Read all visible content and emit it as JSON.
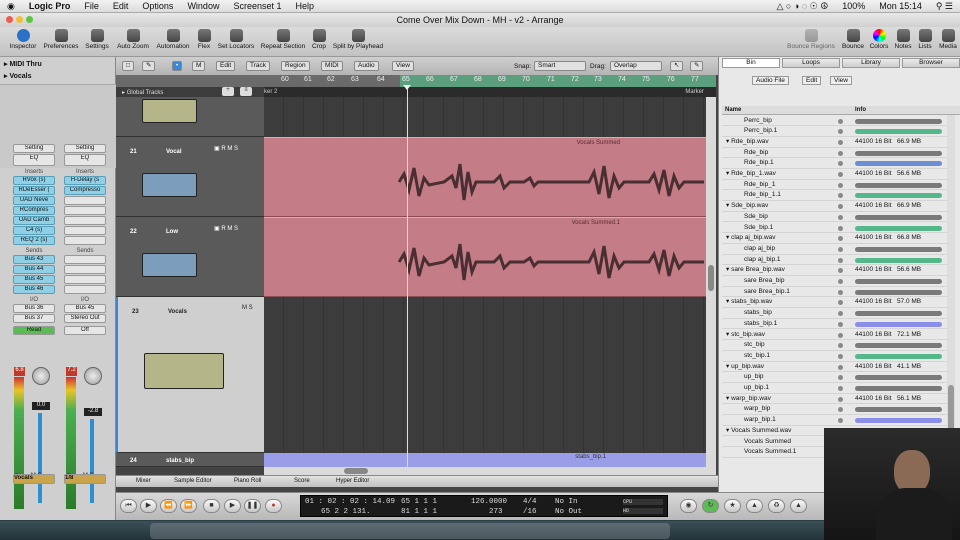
{
  "menubar": {
    "apple": "",
    "app": "Logic Pro",
    "items": [
      "File",
      "Edit",
      "Options",
      "Window",
      "Screenset 1",
      "Help"
    ],
    "battery": "100%",
    "clock": "Mon 15:14"
  },
  "window": {
    "title": "Come Over Mix Down - MH - v2 - Arrange"
  },
  "toolbar": {
    "left": [
      "Inspector",
      "Preferences",
      "Settings",
      "Auto Zoom",
      "Automation",
      "Flex",
      "Set Locators",
      "Repeat Section",
      "Crop",
      "Split by Playhead"
    ],
    "right": [
      "Bounce Regions",
      "Bounce",
      "Colors",
      "Notes",
      "Lists",
      "Media"
    ]
  },
  "inspector": {
    "midi_thru": "MIDI Thru",
    "vocals": "Vocals",
    "strip1": {
      "setting": "Setting",
      "eq": "EQ",
      "inserts_label": "Inserts",
      "inserts": [
        "RVox (s)",
        "RDeEsser (",
        "UAD Neve",
        "RCompres",
        "UAD Camb",
        "C4 (s)",
        "REQ 2 (s)"
      ],
      "sends_label": "Sends",
      "sends": [
        "Bus 43",
        "Bus 44",
        "Bus 45",
        "Bus 46"
      ],
      "io_label": "I/O",
      "io": [
        "Bus 36",
        "Bus 37"
      ],
      "auto": "Read",
      "peak": "6.8",
      "value": "0.0",
      "name": "Vocals"
    },
    "strip2": {
      "setting": "Setting",
      "eq": "EQ",
      "inserts_label": "Inserts",
      "inserts": [
        "H-Delay (s",
        "Compresso"
      ],
      "sends_label": "Sends",
      "io_label": "I/O",
      "io": [
        "Bus 45",
        "Stereo Out"
      ],
      "auto": "Off",
      "peak": "7.2",
      "value": "-2.8",
      "name": "1/8"
    }
  },
  "arrange": {
    "menu": [
      "Edit",
      "Track",
      "Region",
      "MIDI",
      "Audio",
      "View"
    ],
    "snap_label": "Snap:",
    "snap": "Smart",
    "drag_label": "Drag:",
    "drag": "Overlap",
    "ruler": [
      "60",
      "61",
      "62",
      "63",
      "64",
      "65",
      "66",
      "67",
      "68",
      "69",
      "70",
      "71",
      "72",
      "73",
      "74",
      "75",
      "76",
      "77"
    ],
    "global_tracks": "Global Tracks",
    "marker_left": "ker 2",
    "marker_right": "Marker",
    "tracks": [
      {
        "num": "21",
        "name": "Vocal"
      },
      {
        "num": "22",
        "name": "Low"
      },
      {
        "num": "23",
        "name": "Vocals"
      },
      {
        "num": "24",
        "name": "stabs_bip"
      }
    ],
    "regions": [
      "Vocals Summed",
      "Vocals Summed.1",
      "stabs_bip.1"
    ],
    "bottom_tabs": [
      "Mixer",
      "Sample Editor",
      "Piano Roll",
      "Score",
      "Hyper Editor"
    ]
  },
  "bin": {
    "tabs": [
      "Bin",
      "Loops",
      "Library",
      "Browser"
    ],
    "submenu": [
      "Audio File",
      "Edit",
      "View"
    ],
    "col_name": "Name",
    "col_info": "Info",
    "rows": [
      {
        "name": "Perrc_bip",
        "ind": 2,
        "type": "bar",
        "color": "#7a7a7a"
      },
      {
        "name": "Perrc_bip.1",
        "ind": 2,
        "type": "bar",
        "color": "#55b88a"
      },
      {
        "name": "Rde_bip.wav",
        "ind": 1,
        "type": "file",
        "info": "44100 16 Bit",
        "size": "66.9 MB"
      },
      {
        "name": "Rde_bip",
        "ind": 2,
        "type": "bar",
        "color": "#7a7a7a"
      },
      {
        "name": "Rde_bip.1",
        "ind": 2,
        "type": "bar",
        "color": "#6b8fd0"
      },
      {
        "name": "Rde_bip_1.wav",
        "ind": 1,
        "type": "file",
        "info": "44100 16 Bit",
        "size": "56.6 MB"
      },
      {
        "name": "Rde_bip_1",
        "ind": 2,
        "type": "bar",
        "color": "#7a7a7a"
      },
      {
        "name": "Rde_bip_1.1",
        "ind": 2,
        "type": "bar",
        "color": "#55b88a"
      },
      {
        "name": "Sde_bip.wav",
        "ind": 1,
        "type": "file",
        "info": "44100 16 Bit",
        "size": "66.9 MB"
      },
      {
        "name": "Sde_bip",
        "ind": 2,
        "type": "bar",
        "color": "#7a7a7a"
      },
      {
        "name": "Sde_bip.1",
        "ind": 2,
        "type": "bar",
        "color": "#55b88a"
      },
      {
        "name": "clap aj_bip.wav",
        "ind": 1,
        "type": "file",
        "info": "44100 16 Bit",
        "size": "66.8 MB"
      },
      {
        "name": "clap aj_bip",
        "ind": 2,
        "type": "bar",
        "color": "#7a7a7a"
      },
      {
        "name": "clap aj_bip.1",
        "ind": 2,
        "type": "bar",
        "color": "#55b88a"
      },
      {
        "name": "sare Brea_bip.wav",
        "ind": 1,
        "type": "file",
        "info": "44100 16 Bit",
        "size": "56.6 MB"
      },
      {
        "name": "sare Brea_bip",
        "ind": 2,
        "type": "bar",
        "color": "#7a7a7a"
      },
      {
        "name": "sare Brea_bip.1",
        "ind": 2,
        "type": "bar",
        "color": "#7a7a7a"
      },
      {
        "name": "stabs_bip.wav",
        "ind": 1,
        "type": "file",
        "info": "44100 16 Bit",
        "size": "57.0 MB"
      },
      {
        "name": "stabs_bip",
        "ind": 2,
        "type": "bar",
        "color": "#7a7a7a"
      },
      {
        "name": "stabs_bip.1",
        "ind": 2,
        "type": "bar",
        "color": "#8a8ee6"
      },
      {
        "name": "stc_bip.wav",
        "ind": 1,
        "type": "file",
        "info": "44100 16 Bit",
        "size": "72.1 MB"
      },
      {
        "name": "stc_bip",
        "ind": 2,
        "type": "bar",
        "color": "#7a7a7a"
      },
      {
        "name": "stc_bip.1",
        "ind": 2,
        "type": "bar",
        "color": "#55b88a"
      },
      {
        "name": "up_bip.wav",
        "ind": 1,
        "type": "file",
        "info": "44100 16 Bit",
        "size": "41.1 MB"
      },
      {
        "name": "up_bip",
        "ind": 2,
        "type": "bar",
        "color": "#7a7a7a"
      },
      {
        "name": "up_bip.1",
        "ind": 2,
        "type": "bar",
        "color": "#7a7a7a"
      },
      {
        "name": "warp_bip.wav",
        "ind": 1,
        "type": "file",
        "info": "44100 16 Bit",
        "size": "56.1 MB"
      },
      {
        "name": "warp_bip",
        "ind": 2,
        "type": "bar",
        "color": "#7a7a7a"
      },
      {
        "name": "warp_bip.1",
        "ind": 2,
        "type": "bar",
        "color": "#8a8ee6"
      },
      {
        "name": "Vocals Summed.wav",
        "ind": 1,
        "type": "file",
        "info": "",
        "size": ""
      },
      {
        "name": "Vocals Summed",
        "ind": 2,
        "type": "bar",
        "color": "#7a7a7a"
      },
      {
        "name": "Vocals Summed.1",
        "ind": 2,
        "type": "bar",
        "color": "#7a7a7a"
      }
    ]
  },
  "transport": {
    "pos1": "01 : 02 : 02 : 14.09",
    "pos2": "65   2   2  131.",
    "bar1": "65   1   1     1",
    "bar2": "81   1   1     1",
    "tempo": "126.0000",
    "tempo2": "273",
    "sig1": "4/4",
    "sig2": "/16",
    "in": "No In",
    "out": "No Out"
  }
}
